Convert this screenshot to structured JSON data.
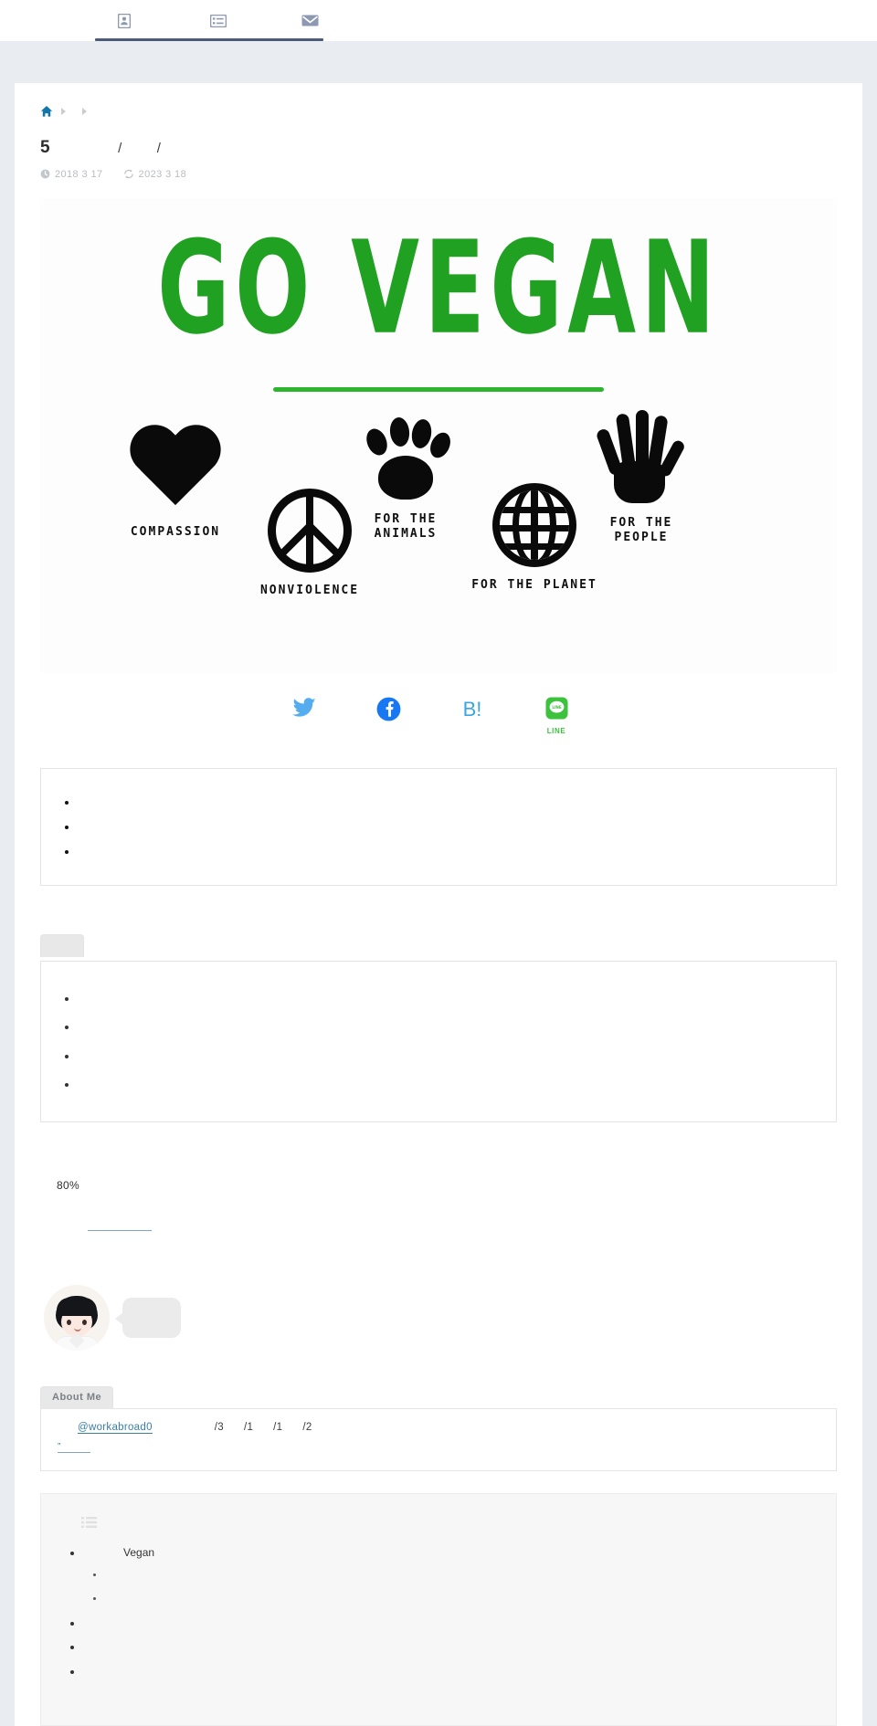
{
  "nav": {
    "items": [
      {
        "name": "profile-card-icon",
        "label": ""
      },
      {
        "name": "list-icon",
        "label": ""
      },
      {
        "name": "mail-icon",
        "label": ""
      }
    ]
  },
  "breadcrumb": {
    "home_label": "",
    "crumb1": "",
    "crumb2": ""
  },
  "post": {
    "title_number": "5",
    "title_part1": "",
    "slash1": "/",
    "title_part2": "",
    "slash2": "/",
    "published_date": "2018 3 17",
    "updated_date": "2023 3 18"
  },
  "hero": {
    "headline": "GO VEGAN",
    "values": [
      {
        "icon": "heart-icon",
        "label": "COMPASSION"
      },
      {
        "icon": "peace-icon",
        "label": "NONVIOLENCE"
      },
      {
        "icon": "paw-icon",
        "label": "FOR THE\nANIMALS"
      },
      {
        "icon": "globe-icon",
        "label": "FOR THE PLANET"
      },
      {
        "icon": "hand-icon",
        "label": "FOR THE\nPEOPLE"
      }
    ]
  },
  "share": {
    "buttons": [
      {
        "name": "twitter-share-button",
        "label": ""
      },
      {
        "name": "facebook-share-button",
        "label": ""
      },
      {
        "name": "hatena-share-button",
        "label": "B!"
      },
      {
        "name": "line-share-button",
        "label": "LINE"
      }
    ]
  },
  "summary_box": {
    "items": [
      "",
      "",
      ""
    ]
  },
  "tab_box": {
    "tab_label": "",
    "items": [
      "",
      "",
      "",
      ""
    ]
  },
  "stats": {
    "percent_label": "80%",
    "link_label": ""
  },
  "profile": {
    "bubble_text": ""
  },
  "about": {
    "tab_label": "About Me",
    "handle": "@workabroad0",
    "fragments": [
      "/3",
      "/1",
      "/1",
      "/2"
    ],
    "quote_link": "”"
  },
  "toc": {
    "items": [
      {
        "label": "Vegan",
        "children": [
          "",
          ""
        ]
      },
      {
        "label": "",
        "children": []
      },
      {
        "label": "",
        "children": []
      },
      {
        "label": "",
        "children": []
      }
    ]
  },
  "colors": {
    "nav_accent": "#4a5a78",
    "breadcrumb_home": "#1276a8",
    "vegan_green": "#21a121",
    "twitter_blue": "#55acee",
    "facebook_blue": "#1877f2",
    "hatena_blue": "#3ba6e0",
    "line_green": "#3dc23d",
    "link_blue": "#3a7fa5",
    "page_bg": "#e9edf2"
  }
}
